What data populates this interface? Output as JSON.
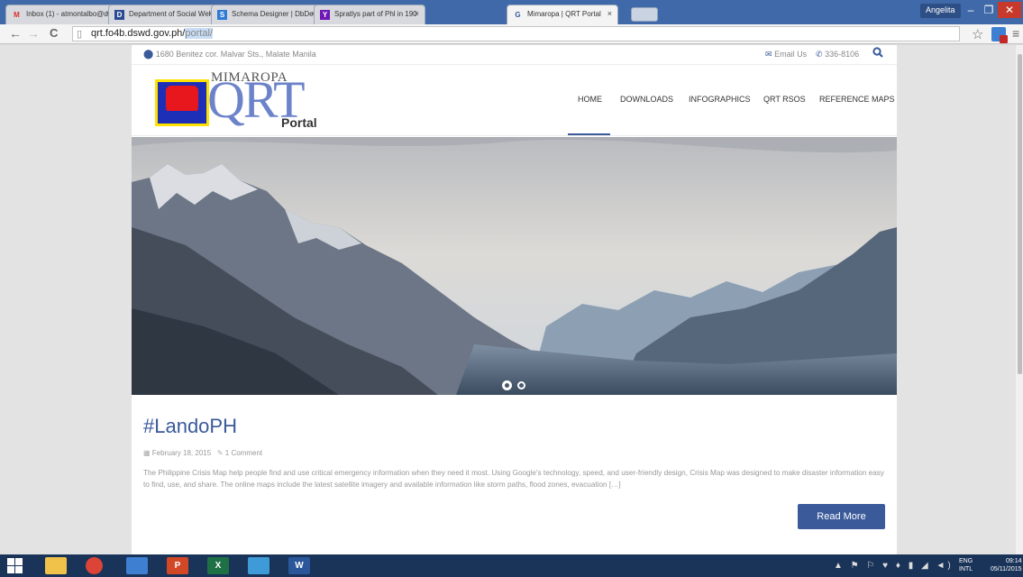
{
  "browser": {
    "tabs": [
      {
        "title": "Inbox (1) - atmontalbo@d",
        "icon": "M",
        "icon_color": "#d93025",
        "active": false
      },
      {
        "title": "Department of Social Wel",
        "icon": "D",
        "icon_color": "#2a4a92",
        "active": false
      },
      {
        "title": "Schema Designer | DbDes",
        "icon": "S",
        "icon_color": "#2d7bd6",
        "active": false
      },
      {
        "title": "Spratlys part of Phl in 190",
        "icon": "Y",
        "icon_color": "#6f17b5",
        "active": false
      },
      {
        "title": "Mimaropa | QRT Portal",
        "icon": "G",
        "icon_color": "#3a5a9a",
        "active": true
      }
    ],
    "tab_close": "×",
    "user": "Angelita",
    "window_controls": {
      "minimize": "–",
      "maximize": "❐",
      "close": "✕"
    },
    "nav_icons": {
      "back": "←",
      "forward": "→",
      "reload": "C",
      "star": "☆",
      "menu": "≡"
    },
    "url_host": "qrt.fo4b.dswd.gov.ph/",
    "url_path": "portal/"
  },
  "site": {
    "topbar": {
      "address": "1680 Benitez cor. Malvar Sts., Malate Manila",
      "email_label": "Email Us",
      "phone": "336-8106"
    },
    "logo": {
      "region": "MIMAROPA",
      "brand": "QRT",
      "sub": "Portal"
    },
    "nav": [
      {
        "label": "HOME",
        "active": true
      },
      {
        "label": "DOWNLOADS",
        "active": false
      },
      {
        "label": "INFOGRAPHICS",
        "active": false
      },
      {
        "label": "QRT RSOS",
        "active": false
      },
      {
        "label": "REFERENCE MAPS",
        "active": false
      }
    ],
    "slider": {
      "total_slides": 2,
      "current_slide": 1
    },
    "post": {
      "title": "#LandoPH",
      "date": "February 18, 2015",
      "comments": "1 Comment",
      "excerpt": "The Philippine Crisis Map help people find and use critical emergency information when they need it most. Using Google's technology, speed, and user-friendly design, Crisis Map was designed to make disaster information easy to find, use, and share. The online maps include the latest satellite imagery and available information like storm paths, flood zones, evacuation […]",
      "read_more": "Read More"
    }
  },
  "taskbar": {
    "apps": [
      {
        "name": "file-explorer",
        "label": "",
        "color": "#f0c24a"
      },
      {
        "name": "chrome",
        "label": "",
        "color": "#db4437"
      },
      {
        "name": "ftp-client",
        "label": "",
        "color": "#3e7fd1"
      },
      {
        "name": "powerpoint",
        "label": "P",
        "color": "#d24726"
      },
      {
        "name": "excel",
        "label": "X",
        "color": "#1e7145"
      },
      {
        "name": "notepad",
        "label": "",
        "color": "#3e9bd8"
      },
      {
        "name": "word",
        "label": "W",
        "color": "#2b579a"
      }
    ],
    "lang_top": "ENG",
    "lang_bottom": "INTL",
    "time": "09:14",
    "date": "05/11/2015"
  },
  "colors": {
    "accent": "#3a5a9a",
    "taskbar": "#1a3358",
    "chrome_frame": "#3f69a8"
  }
}
